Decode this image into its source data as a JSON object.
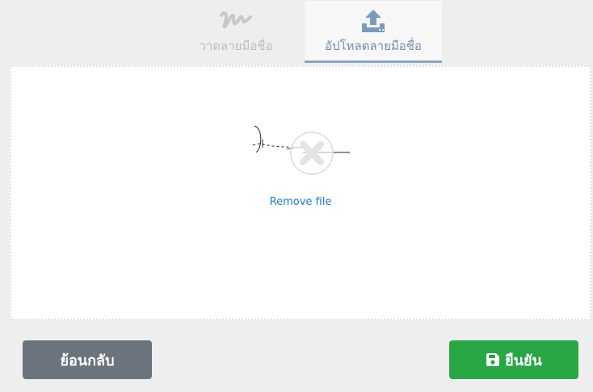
{
  "tabs": [
    {
      "label": "วาดลายมือชื่อ",
      "icon": "signature-icon",
      "active": false
    },
    {
      "label": "อัปโหลดลายมือชื่อ",
      "icon": "upload-icon",
      "active": true
    }
  ],
  "dropzone": {
    "remove_label": "Remove file",
    "preview_icon": "remove-x-icon"
  },
  "buttons": {
    "back_label": "ย้อนกลับ",
    "confirm_label": "ยืนยัน",
    "confirm_icon": "save-icon"
  },
  "colors": {
    "accent": "#8aa6c1",
    "confirm": "#28a745",
    "back": "#6b737d",
    "link": "#1d7be0"
  }
}
